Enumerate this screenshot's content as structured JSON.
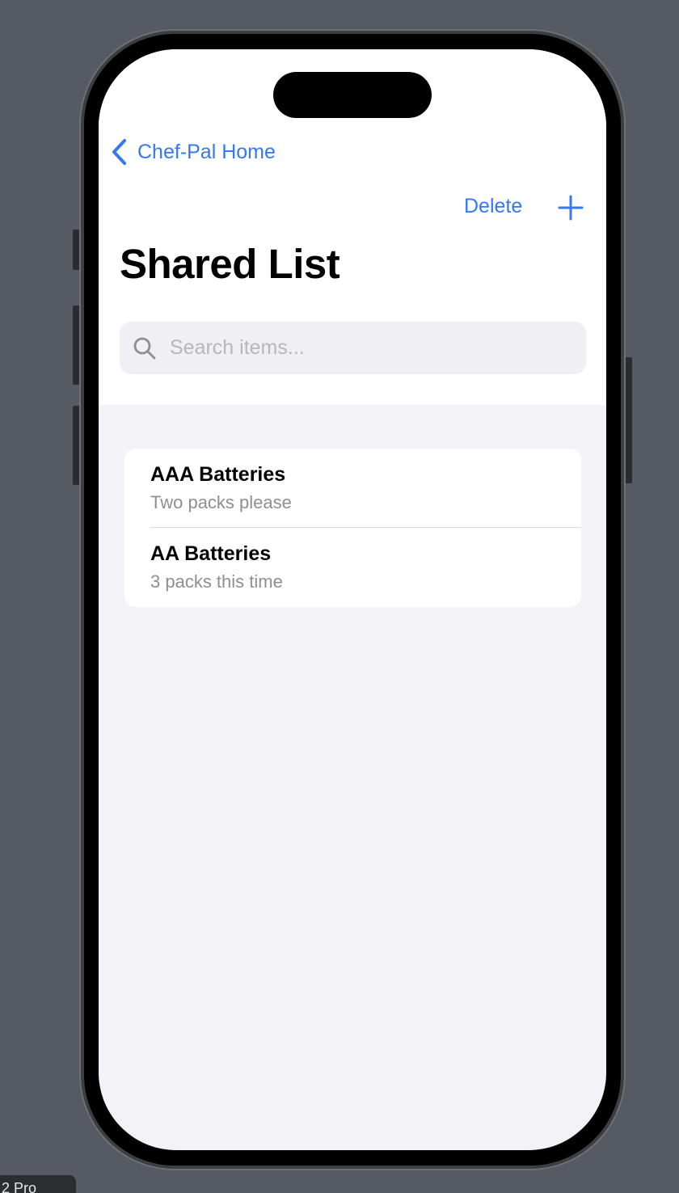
{
  "nav": {
    "back_label": "Chef-Pal Home",
    "delete_label": "Delete",
    "add_icon": "plus-icon",
    "back_icon": "chevron-left-icon"
  },
  "page": {
    "title": "Shared List"
  },
  "search": {
    "placeholder": "Search items...",
    "value": "",
    "icon": "search-icon"
  },
  "items": [
    {
      "title": "AAA Batteries",
      "subtitle": "Two packs please"
    },
    {
      "title": "AA Batteries",
      "subtitle": "3 packs this time"
    }
  ],
  "simulator": {
    "device_label": "2 Pro"
  },
  "colors": {
    "accent": "#3478f6",
    "list_background": "#f2f2f7",
    "secondary_text": "#8e8e93"
  }
}
